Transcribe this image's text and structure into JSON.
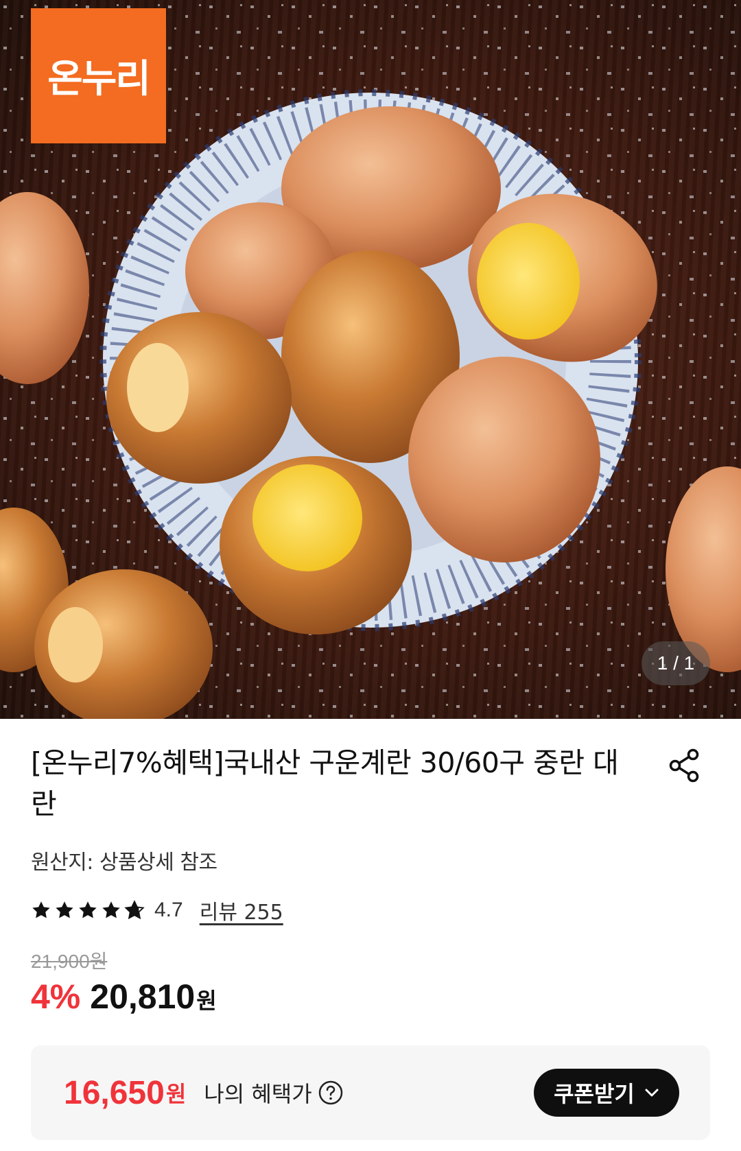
{
  "hero": {
    "brand_logo_text": "온누리",
    "brand_color": "#f36c21",
    "image_counter": "1 / 1"
  },
  "product": {
    "title": "[온누리7%혜택]국내산 구운계란 30/60구 중란 대란",
    "origin": "원산지: 상품상세 참조",
    "rating": "4.7",
    "stars_filled": 4.7,
    "stars_total": 5,
    "review_label": "리뷰 255",
    "original_price": "21,900원",
    "discount_rate": "4%",
    "sale_price": "20,810",
    "won_unit": "원"
  },
  "benefit": {
    "price": "16,650",
    "won_unit": "원",
    "label": "나의 혜택가",
    "coupon_button_label": "쿠폰받기"
  },
  "icons": {
    "share": "share-icon",
    "star": "star-icon",
    "help": "question-circle-icon",
    "chevron": "chevron-down-icon"
  },
  "colors": {
    "accent_red": "#f0333a",
    "button_dark": "#0f0f0f"
  }
}
